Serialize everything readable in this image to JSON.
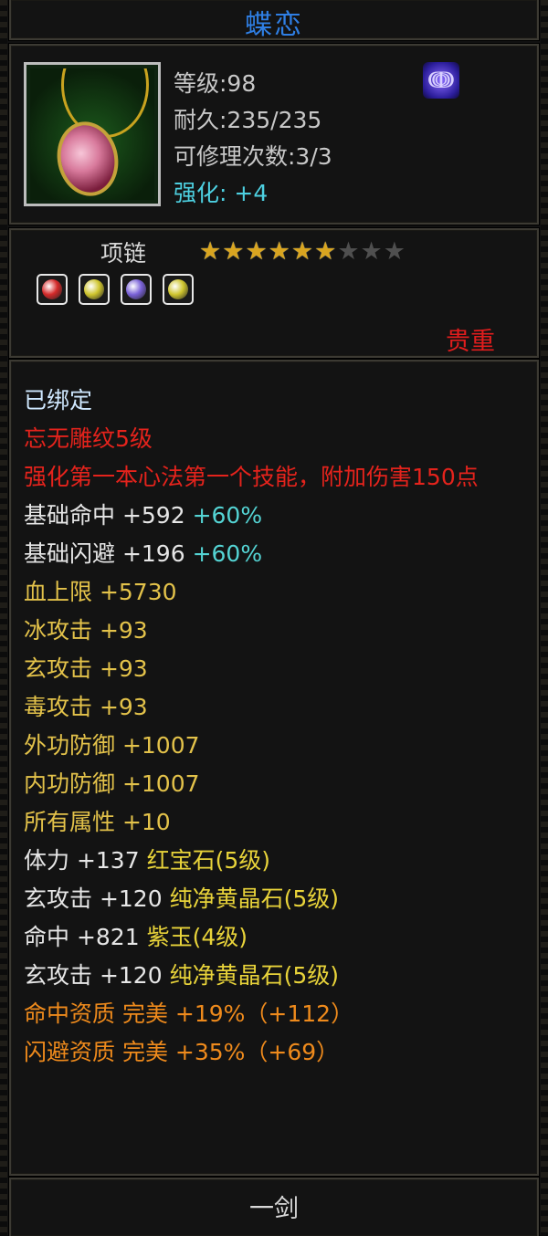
{
  "title": "蝶恋",
  "header": {
    "level": "等级:98",
    "durability": "耐久:235/235",
    "repairs": "可修理次数:3/3",
    "enhance": "强化: +4"
  },
  "type": "项链",
  "stars": {
    "filled": 6,
    "total": 9
  },
  "gems": [
    {
      "icon": "red-gem-icon",
      "color": "#d42a2a"
    },
    {
      "icon": "yellow-gem-icon",
      "color": "#cfc52e"
    },
    {
      "icon": "purple-gem-icon",
      "color": "#7a62d8"
    },
    {
      "icon": "yellow-gem-icon",
      "color": "#cfc52e"
    }
  ],
  "rarity": "贵重",
  "lines": [
    {
      "text": "已绑定",
      "cls": "c-cyan"
    },
    {
      "text": "忘无雕纹5级",
      "cls": "c-red"
    },
    {
      "text": "强化第一本心法第一个技能，附加伤害150点",
      "cls": "c-red"
    },
    {
      "text": "基础命中 +592",
      "extra": "+60%",
      "cls": "c-white"
    },
    {
      "text": "基础闪避 +196",
      "extra": "+60%",
      "cls": "c-white"
    },
    {
      "text": "血上限 +5730",
      "cls": "c-gold"
    },
    {
      "text": "冰攻击 +93",
      "cls": "c-gold"
    },
    {
      "text": "玄攻击 +93",
      "cls": "c-gold"
    },
    {
      "text": "毒攻击 +93",
      "cls": "c-gold"
    },
    {
      "text": "外功防御 +1007",
      "cls": "c-gold"
    },
    {
      "text": "内功防御 +1007",
      "cls": "c-gold"
    },
    {
      "text": "所有属性 +10",
      "cls": "c-gold"
    },
    {
      "text": "体力 +137",
      "extra": "红宝石(5级)",
      "cls": "c-white"
    },
    {
      "text": "玄攻击 +120",
      "extra": "纯净黄晶石(5级)",
      "cls": "c-white"
    },
    {
      "text": "命中 +821",
      "extra": "紫玉(4级)",
      "cls": "c-white"
    },
    {
      "text": "玄攻击 +120",
      "extra": "纯净黄晶石(5级)",
      "cls": "c-white"
    },
    {
      "text": "命中资质  完美 +19%（+112）",
      "cls": "c-orange"
    },
    {
      "text": "闪避资质  完美 +35%（+69）",
      "cls": "c-orange"
    }
  ],
  "footer": "一剑",
  "colors": {
    "title": "#2f7fe4",
    "enhance": "#4dd0e1",
    "rare": "#e11d1d",
    "gold": "#e3c24a"
  }
}
